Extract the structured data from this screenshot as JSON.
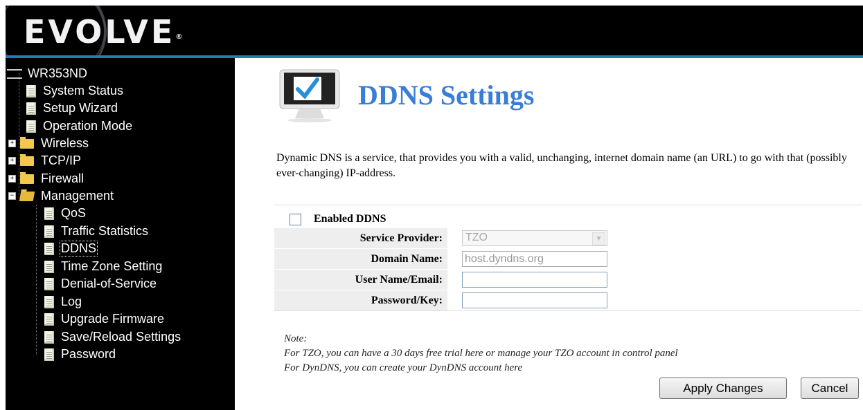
{
  "header": {
    "logo_text": "EVOLVE",
    "logo_mark": "®"
  },
  "sidebar": {
    "root": "WR353ND",
    "items": [
      {
        "label": "System Status",
        "type": "page"
      },
      {
        "label": "Setup Wizard",
        "type": "page"
      },
      {
        "label": "Operation Mode",
        "type": "page"
      },
      {
        "label": "Wireless",
        "type": "folder"
      },
      {
        "label": "TCP/IP",
        "type": "folder"
      },
      {
        "label": "Firewall",
        "type": "folder"
      },
      {
        "label": "Management",
        "type": "folder-open"
      }
    ],
    "management_items": [
      {
        "label": "QoS"
      },
      {
        "label": "Traffic Statistics"
      },
      {
        "label": "DDNS",
        "selected": true
      },
      {
        "label": "Time Zone Setting"
      },
      {
        "label": "Denial-of-Service"
      },
      {
        "label": "Log"
      },
      {
        "label": "Upgrade Firmware"
      },
      {
        "label": "Save/Reload Settings"
      },
      {
        "label": "Password"
      }
    ]
  },
  "main": {
    "title": "DDNS Settings",
    "description": "Dynamic DNS is a service, that provides you with a valid, unchanging, internet domain name (an URL) to go with that (possibly ever-changing) IP-address.",
    "enable_label": "Enabled DDNS",
    "enable_checked": false,
    "fields": {
      "provider_label": "Service Provider:",
      "provider_value": "TZO",
      "domain_label": "Domain Name:",
      "domain_value": "host.dyndns.org",
      "user_label": "User Name/Email:",
      "user_value": "",
      "password_label": "Password/Key:",
      "password_value": ""
    },
    "note": {
      "heading": "Note:",
      "line1": "For TZO, you can have a 30 days free trial here or manage your TZO account in control panel",
      "line2": "For DynDNS, you can create your DynDNS account here"
    },
    "apply_label": "Apply Changes",
    "cancel_label": "Cancel"
  },
  "colors": {
    "title": "#3a7dd8",
    "header_bar": "#1b7fb0",
    "sidebar_bg": "#000000"
  }
}
